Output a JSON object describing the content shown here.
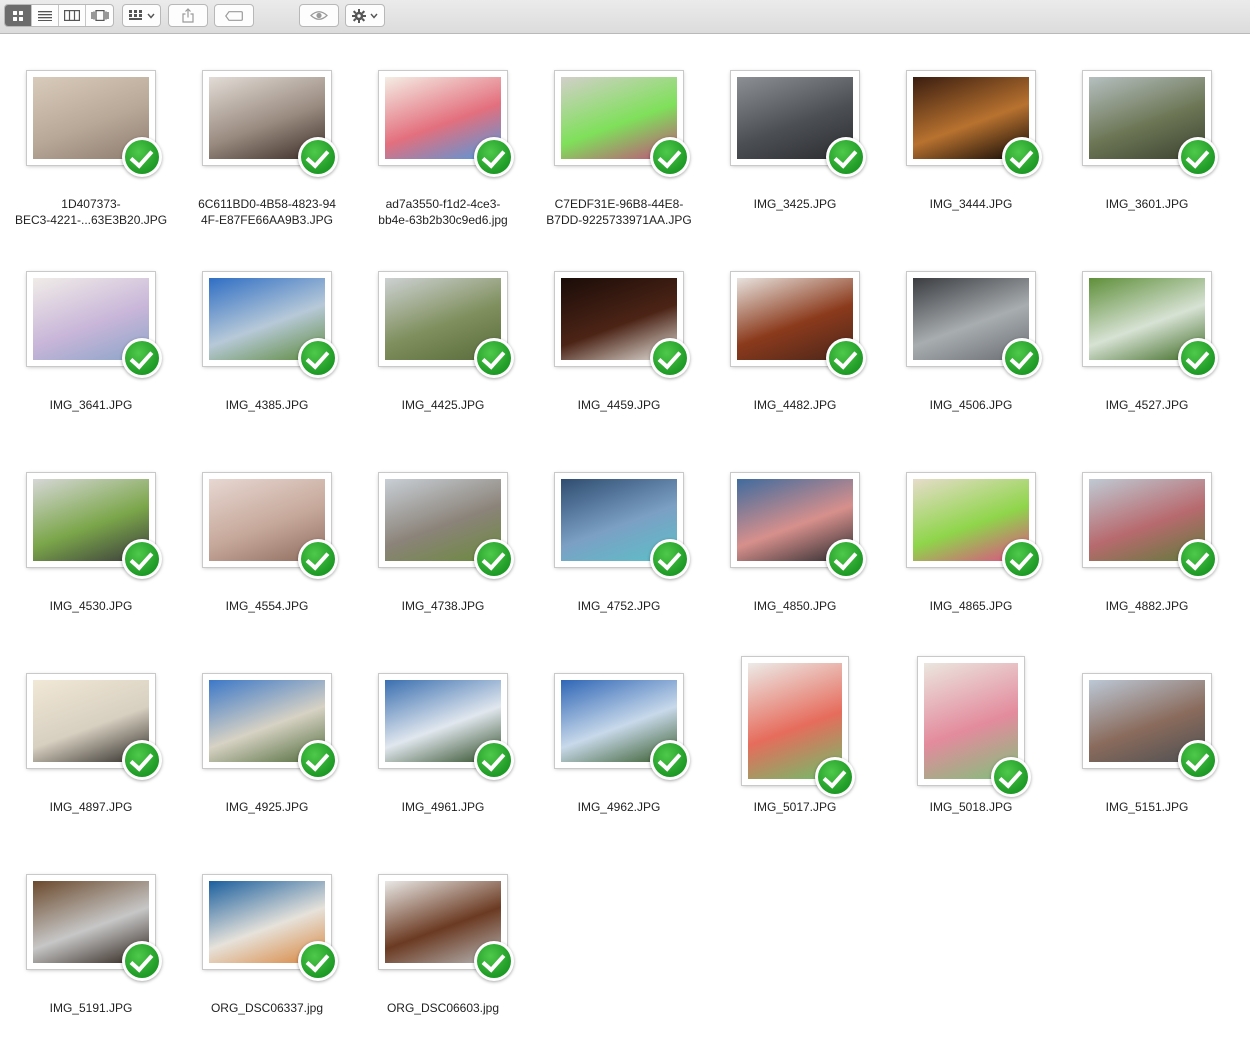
{
  "toolbar": {
    "view_modes": [
      {
        "name": "view-icons-button",
        "icon": "icon-grid-icon",
        "active": true
      },
      {
        "name": "view-list-button",
        "icon": "list-icon",
        "active": false
      },
      {
        "name": "view-columns-button",
        "icon": "columns-icon",
        "active": false
      },
      {
        "name": "view-coverflow-button",
        "icon": "coverflow-icon",
        "active": false
      }
    ],
    "buttons": {
      "arrange": {
        "icon": "arrange-grid-icon"
      },
      "share": {
        "icon": "share-icon"
      },
      "tags": {
        "icon": "tag-icon"
      },
      "quicklook": {
        "icon": "eye-icon"
      },
      "action": {
        "icon": "gear-icon"
      }
    }
  },
  "colors": {
    "toolbar_bg": "#e3e3e3",
    "active_segment": "#6c6c6c",
    "check_green": "#26a22c"
  },
  "files": [
    {
      "name": "1D407373-BEC3-4221-...63E3B20.JPG",
      "name_display": "1D407373-\nBEC3-4221-...63E3B20.JPG",
      "orient": "landscape",
      "colors": [
        "#d9cbbb",
        "#b8a898",
        "#8e7d6f"
      ]
    },
    {
      "name": "6C611BD0-4B58-4823-944F-E87FE66AA9B3.JPG",
      "name_display": "6C611BD0-4B58-4823-94\n4F-E87FE66AA9B3.JPG",
      "orient": "landscape",
      "colors": [
        "#e2dcd6",
        "#9a8b80",
        "#3a2c26"
      ]
    },
    {
      "name": "ad7a3550-f1d2-4ce3-bb4e-63b2b30c9ed6.jpg",
      "name_display": "ad7a3550-f1d2-4ce3-\nbb4e-63b2b30c9ed6.jpg",
      "orient": "landscape",
      "colors": [
        "#f4ede4",
        "#e36f7d",
        "#4f9adf"
      ]
    },
    {
      "name": "C7EDF31E-96B8-44E8-B7DD-9225733971AA.JPG",
      "name_display": "C7EDF31E-96B8-44E8-\nB7DD-9225733971AA.JPG",
      "orient": "landscape",
      "colors": [
        "#d2cfc9",
        "#7fe05a",
        "#c24f7b"
      ]
    },
    {
      "name": "IMG_3425.JPG",
      "orient": "landscape",
      "colors": [
        "#8c8f93",
        "#4c4f54",
        "#2a2c2f"
      ]
    },
    {
      "name": "IMG_3444.JPG",
      "orient": "landscape",
      "colors": [
        "#3a1d10",
        "#b8722f",
        "#0c0705"
      ]
    },
    {
      "name": "IMG_3601.JPG",
      "orient": "landscape",
      "colors": [
        "#b5bfbf",
        "#6c7655",
        "#3b4230"
      ]
    },
    {
      "name": "IMG_3641.JPG",
      "orient": "landscape",
      "colors": [
        "#f0ece8",
        "#c9b6d9",
        "#8aa4c8"
      ]
    },
    {
      "name": "IMG_4385.JPG",
      "orient": "landscape",
      "colors": [
        "#2f6ec4",
        "#b7c9d8",
        "#5d8a3c"
      ]
    },
    {
      "name": "IMG_4425.JPG",
      "orient": "landscape",
      "colors": [
        "#cdd1d2",
        "#7f8f5d",
        "#596b3b"
      ]
    },
    {
      "name": "IMG_4459.JPG",
      "orient": "landscape",
      "colors": [
        "#1a0c08",
        "#4c2416",
        "#e6e3dd"
      ]
    },
    {
      "name": "IMG_4482.JPG",
      "orient": "landscape",
      "colors": [
        "#e8e3df",
        "#8b3a1c",
        "#4a261a"
      ]
    },
    {
      "name": "IMG_4506.JPG",
      "orient": "landscape",
      "colors": [
        "#3a3c40",
        "#a8adb0",
        "#6a6e73"
      ]
    },
    {
      "name": "IMG_4527.JPG",
      "orient": "landscape",
      "colors": [
        "#5f8f3a",
        "#d7e2d4",
        "#3d6a23"
      ]
    },
    {
      "name": "IMG_4530.JPG",
      "orient": "landscape",
      "colors": [
        "#d6d7d6",
        "#7ba64a",
        "#3a3b3c"
      ]
    },
    {
      "name": "IMG_4554.JPG",
      "orient": "landscape",
      "colors": [
        "#e7d7d2",
        "#c6a89a",
        "#8e6c5e"
      ]
    },
    {
      "name": "IMG_4738.JPG",
      "orient": "landscape",
      "colors": [
        "#c8cfd6",
        "#8b8379",
        "#6b8a3c"
      ]
    },
    {
      "name": "IMG_4752.JPG",
      "orient": "landscape",
      "colors": [
        "#2e4c70",
        "#7ba0c4",
        "#5bc0c8"
      ]
    },
    {
      "name": "IMG_4850.JPG",
      "orient": "landscape",
      "colors": [
        "#3f6b9e",
        "#d7908c",
        "#2a2a2e"
      ]
    },
    {
      "name": "IMG_4865.JPG",
      "orient": "landscape",
      "colors": [
        "#e6dcca",
        "#8fd54a",
        "#e04a86"
      ]
    },
    {
      "name": "IMG_4882.JPG",
      "orient": "landscape",
      "colors": [
        "#bfcad4",
        "#b76a6e",
        "#5f7a3a"
      ]
    },
    {
      "name": "IMG_4897.JPG",
      "orient": "landscape",
      "colors": [
        "#f1e8d6",
        "#d7cfc0",
        "#2d2a26"
      ]
    },
    {
      "name": "IMG_4925.JPG",
      "orient": "landscape",
      "colors": [
        "#3c78c8",
        "#d7d2c4",
        "#4f6a3a"
      ]
    },
    {
      "name": "IMG_4961.JPG",
      "orient": "landscape",
      "colors": [
        "#3a6fb0",
        "#e1e7ee",
        "#2c4a24"
      ]
    },
    {
      "name": "IMG_4962.JPG",
      "orient": "landscape",
      "colors": [
        "#2f66b6",
        "#c8d9ea",
        "#365a2a"
      ]
    },
    {
      "name": "IMG_5017.JPG",
      "orient": "portrait",
      "colors": [
        "#ecebe8",
        "#e66c5c",
        "#6cc06a"
      ]
    },
    {
      "name": "IMG_5018.JPG",
      "orient": "portrait",
      "colors": [
        "#ebe6df",
        "#e38b9d",
        "#7fc07a"
      ]
    },
    {
      "name": "IMG_5151.JPG",
      "orient": "landscape",
      "colors": [
        "#bcc8d6",
        "#8a6b5c",
        "#4d4f52"
      ]
    },
    {
      "name": "IMG_5191.JPG",
      "orient": "landscape",
      "colors": [
        "#6b4a2d",
        "#c7c7c7",
        "#2a1f17"
      ]
    },
    {
      "name": "ORG_DSC06337.jpg",
      "orient": "landscape",
      "colors": [
        "#1a5f9e",
        "#e6e2da",
        "#d8843b"
      ]
    },
    {
      "name": "ORG_DSC06603.jpg",
      "orient": "landscape",
      "colors": [
        "#e9e8e6",
        "#6b3a22",
        "#b7b7b7"
      ]
    }
  ]
}
